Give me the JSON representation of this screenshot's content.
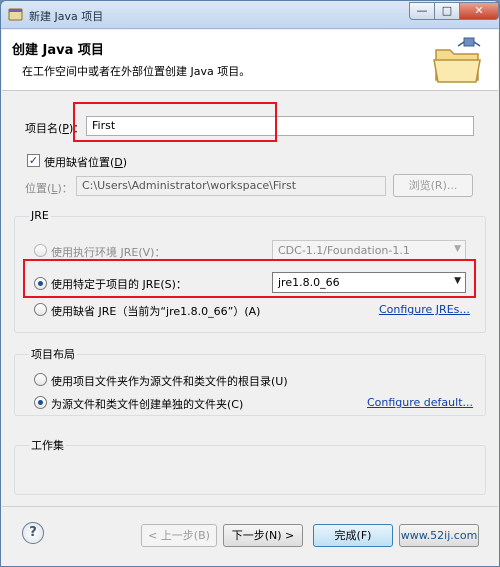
{
  "window": {
    "title": "新建 Java 项目",
    "controls": {
      "minimize": "—",
      "maximize": "□",
      "close": "✕"
    }
  },
  "header": {
    "title": "创建 Java 项目",
    "description": "在工作空间中或者在外部位置创建 Java 项目。",
    "icon": "folder-wizard-icon"
  },
  "project_name": {
    "label": "项目名(",
    "mnemonic": "P",
    "label_end": ")：",
    "value": "First"
  },
  "default_location": {
    "label": "使用缺省位置(",
    "mnemonic": "D",
    "label_end": ")",
    "checked": true
  },
  "location": {
    "label": "位置(",
    "mnemonic": "L",
    "label_end": ")：",
    "value": "C:\\Users\\Administrator\\workspace\\First",
    "browse_label": "浏览(R)..."
  },
  "jre": {
    "group_title": "JRE",
    "options": [
      {
        "label": "使用执行环境 JRE(V)：",
        "selected": false,
        "enabled": false,
        "combo": "CDC-1.1/Foundation-1.1"
      },
      {
        "label": "使用特定于项目的 JRE(S)：",
        "selected": true,
        "enabled": true,
        "combo": "jre1.8.0_66"
      },
      {
        "label": "使用缺省 JRE（当前为“jre1.8.0_66”）(A)",
        "selected": false,
        "enabled": true
      }
    ],
    "configure_link": "Configure JREs..."
  },
  "layout": {
    "group_title": "项目布局",
    "options": [
      {
        "label": "使用项目文件夹作为源文件和类文件的根目录(U)",
        "selected": false
      },
      {
        "label": "为源文件和类文件创建单独的文件夹(C)",
        "selected": true
      }
    ],
    "configure_link": "Configure default..."
  },
  "working_sets": {
    "group_title": "工作集"
  },
  "footer": {
    "help": "?",
    "back": "< 上一步(B)",
    "next": "下一步(N) >",
    "finish": "完成(F)",
    "watermark": "www.52ij.com"
  },
  "colors": {
    "highlight_box": "#e8131b",
    "link": "#0b3fa6"
  }
}
